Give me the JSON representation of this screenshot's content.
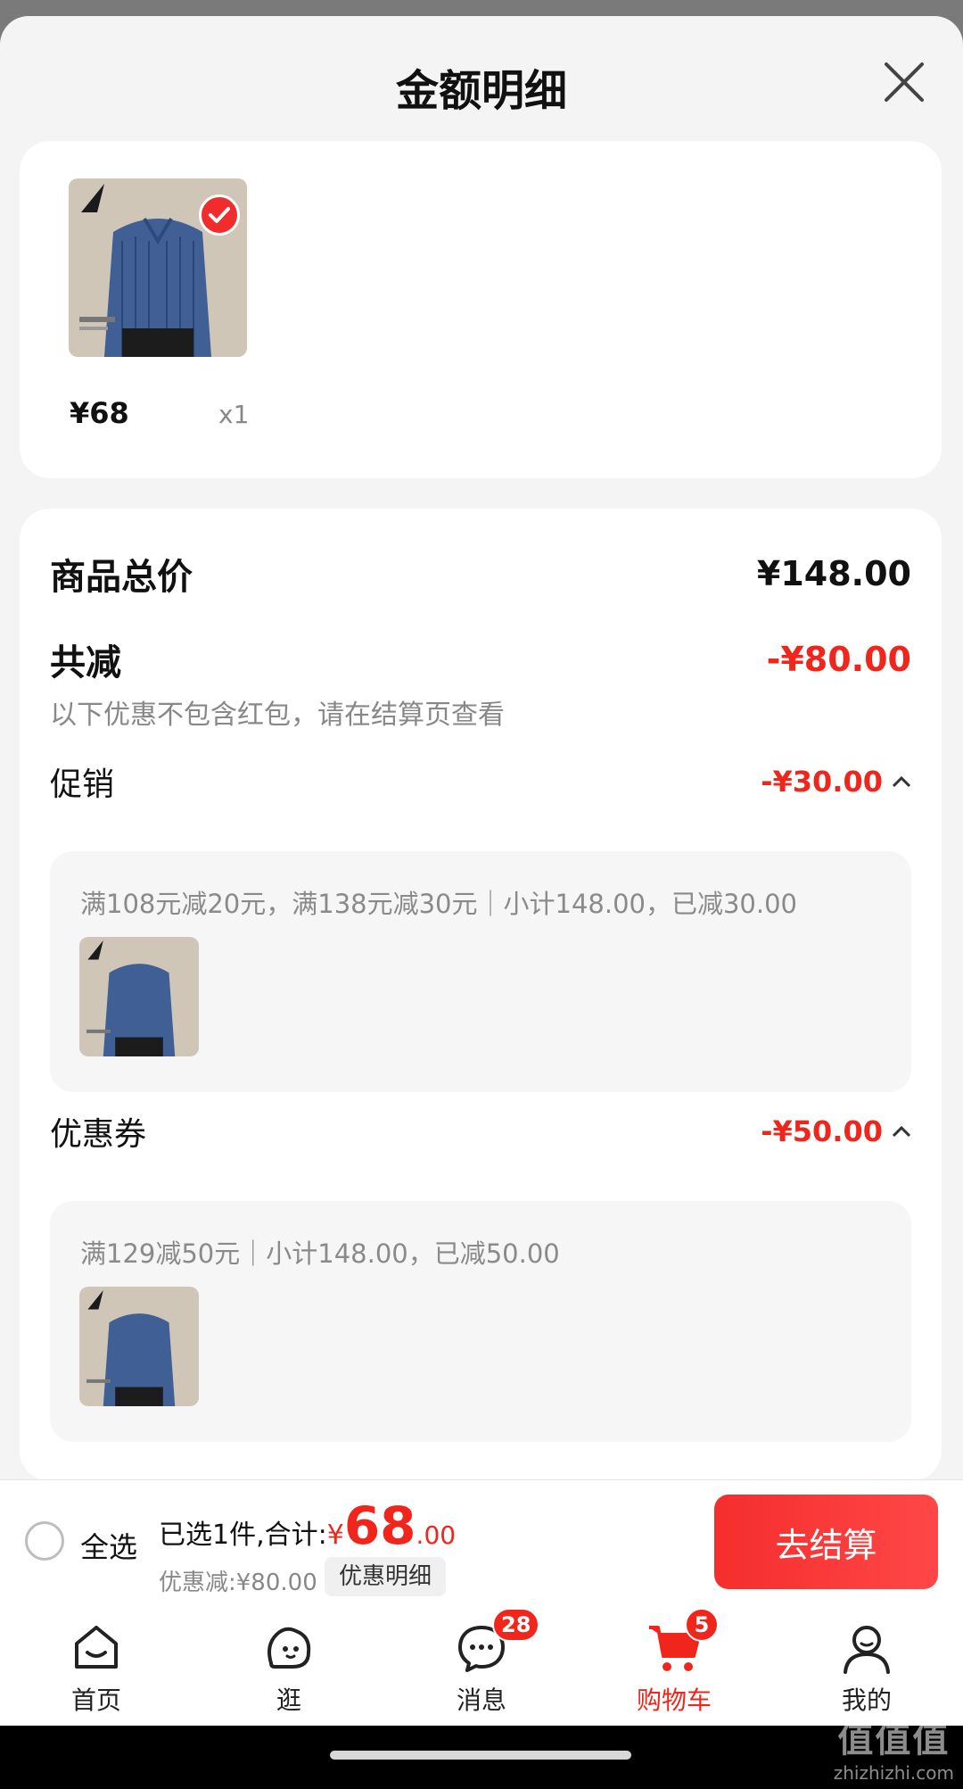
{
  "sheet": {
    "title": "金额明细"
  },
  "item": {
    "price": "¥68",
    "qty": "x1"
  },
  "summary": {
    "total_label": "商品总价",
    "total_value": "¥148.00",
    "reduce_label": "共减",
    "reduce_value": "-¥80.00",
    "note": "以下优惠不包含红包，请在结算页查看"
  },
  "promotion": {
    "label": "促销",
    "value": "-¥30.00",
    "detail": "满108元减20元，满138元减30元｜小计148.00，已减30.00"
  },
  "coupon": {
    "label": "优惠券",
    "value": "-¥50.00",
    "detail": "满129减50元｜小计148.00，已减50.00"
  },
  "bottom": {
    "select_all": "全选",
    "selected_text": "已选1件,合计:",
    "currency": "¥",
    "amount_int": "68",
    "amount_dec": ".00",
    "discount_text": "优惠减:¥80.00",
    "detail_chip": "优惠明细",
    "checkout": "去结算"
  },
  "tabs": [
    {
      "label": "首页",
      "icon": "home-icon"
    },
    {
      "label": "逛",
      "icon": "browse-icon"
    },
    {
      "label": "消息",
      "icon": "message-icon",
      "badge": "28"
    },
    {
      "label": "购物车",
      "icon": "cart-icon",
      "badge": "5",
      "active": true
    },
    {
      "label": "我的",
      "icon": "profile-icon"
    }
  ],
  "watermark": {
    "logo": "值值值",
    "domain": "zhizhizhi.com"
  },
  "colors": {
    "accent": "#f0261d",
    "checkout": "#f52d2d"
  }
}
